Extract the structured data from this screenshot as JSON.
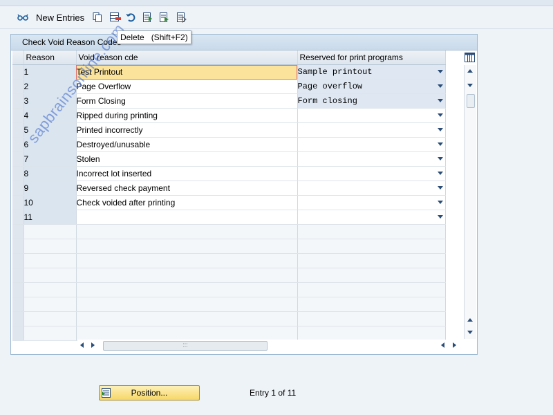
{
  "toolbar": {
    "new_entries_label": "New Entries",
    "buttons": [
      "glasses-icon",
      "copy-icon",
      "delete-icon",
      "undo-icon",
      "select-all-icon",
      "select-block-icon",
      "deselect-all-icon"
    ]
  },
  "tooltip": {
    "text": "Delete   (Shift+F2)"
  },
  "panel": {
    "title": "Check Void Reason Codes",
    "columns": [
      "Reason",
      "Void reason cde",
      "Reserved for print programs"
    ],
    "rows": [
      {
        "reason": "1",
        "text": "Test Printout",
        "reserved": "Sample printout"
      },
      {
        "reason": "2",
        "text": "Page Overflow",
        "reserved": "Page overflow"
      },
      {
        "reason": "3",
        "text": "Form Closing",
        "reserved": "Form closing"
      },
      {
        "reason": "4",
        "text": "Ripped during printing",
        "reserved": ""
      },
      {
        "reason": "5",
        "text": "Printed incorrectly",
        "reserved": ""
      },
      {
        "reason": "6",
        "text": "Destroyed/unusable",
        "reserved": ""
      },
      {
        "reason": "7",
        "text": "Stolen",
        "reserved": ""
      },
      {
        "reason": "8",
        "text": "Incorrect lot inserted",
        "reserved": ""
      },
      {
        "reason": "9",
        "text": "Reversed check payment",
        "reserved": ""
      },
      {
        "reason": "10",
        "text": "Check voided after printing",
        "reserved": ""
      },
      {
        "reason": "11",
        "text": "",
        "reserved": ""
      }
    ]
  },
  "footer": {
    "position_label": "Position...",
    "entry_info": "Entry 1 of 11"
  },
  "watermark": "sapbrainsonline.com",
  "colors": {
    "active_cell": "#fbe39c",
    "header": "#c9daeb",
    "button": "#f7d768"
  }
}
